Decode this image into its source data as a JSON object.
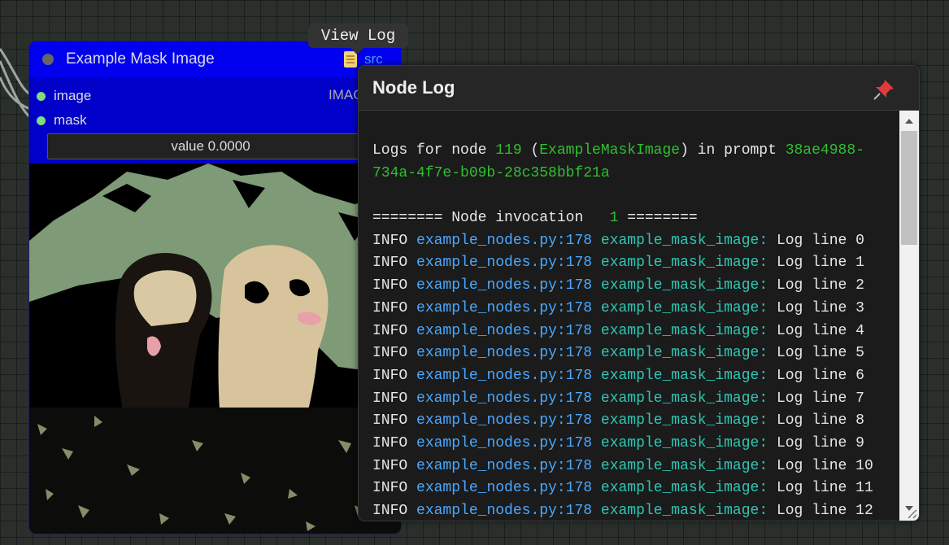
{
  "node": {
    "title": "Example Mask Image",
    "src_label": "src",
    "inputs": [
      "image",
      "mask"
    ],
    "output_label": "IMAGE",
    "widget_value": "value  0.0000"
  },
  "tooltip": {
    "text": "View Log"
  },
  "log_panel": {
    "title": "Node Log",
    "header": {
      "prefix": "Logs for node ",
      "node_id": "119",
      "open_paren": " (",
      "node_class": "ExampleMaskImage",
      "mid": ") in prompt ",
      "prompt_id_1": "38ae4988-",
      "prompt_id_2": "734a-4f7e-b09b-28c358bbf21a"
    },
    "invocation": {
      "prefix": "======== Node invocation   ",
      "number": "1",
      "suffix": " ========"
    },
    "line_level": "INFO",
    "line_source": "example_nodes.py:178",
    "line_logger": "example_mask_image:",
    "lines": [
      "Log line 0",
      "Log line 1",
      "Log line 2",
      "Log line 3",
      "Log line 4",
      "Log line 5",
      "Log line 6",
      "Log line 7",
      "Log line 8",
      "Log line 9",
      "Log line 10",
      "Log line 11",
      "Log line 12"
    ]
  },
  "icons": {
    "title": "file-icon",
    "pin": "pin-icon"
  },
  "colors": {
    "node_title_bg": "#0000ee",
    "node_body_bg": "#0000c8",
    "slot_dot": "#7edc7e",
    "log_number": "#2fbf2f",
    "log_source": "#4aa8ff",
    "log_logger": "#2fc6b4"
  }
}
